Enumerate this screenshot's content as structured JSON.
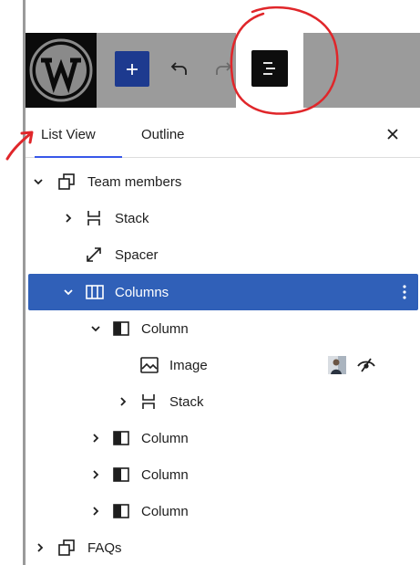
{
  "toolbar": {
    "logo": "wordpress-logo",
    "add_icon": "plus-icon",
    "undo_icon": "undo-icon",
    "redo_icon": "redo-icon",
    "list_view_icon": "list-view-icon",
    "add_color": "#1d3a8f"
  },
  "tabs": {
    "list_view": "List View",
    "outline": "Outline",
    "close_icon": "close-icon"
  },
  "tree": [
    {
      "label": "Team members",
      "icon": "group-icon",
      "expanded": true
    },
    {
      "label": "Stack",
      "icon": "stack-icon",
      "expanded": false
    },
    {
      "label": "Spacer",
      "icon": "spacer-icon"
    },
    {
      "label": "Columns",
      "icon": "columns-icon",
      "expanded": true,
      "selected": true
    },
    {
      "label": "Column",
      "icon": "column-icon",
      "expanded": true
    },
    {
      "label": "Image",
      "icon": "image-icon",
      "hidden": true
    },
    {
      "label": "Stack",
      "icon": "stack-icon",
      "expanded": false
    },
    {
      "label": "Column",
      "icon": "column-icon",
      "expanded": false
    },
    {
      "label": "Column",
      "icon": "column-icon",
      "expanded": false
    },
    {
      "label": "Column",
      "icon": "column-icon",
      "expanded": false
    },
    {
      "label": "FAQs",
      "icon": "group-icon",
      "expanded": false
    }
  ],
  "colors": {
    "selected": "#3060b8",
    "tab_accent": "#3858e9",
    "annotation": "#e0262a"
  }
}
